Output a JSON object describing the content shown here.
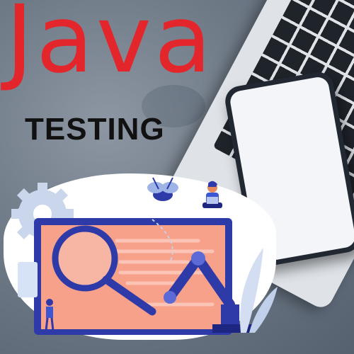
{
  "headline": "Java",
  "subheadline": "TESTING",
  "colors": {
    "headline": "#e3262b",
    "subheadline": "#111111",
    "background": "#6f7a87",
    "illustration_screen": "#f7a08a",
    "illustration_accent": "#2e3aa8"
  },
  "icons": [
    "gear-icon",
    "magnifying-glass-icon",
    "robotic-arm-icon",
    "bug-icon",
    "person-with-laptop-icon",
    "plant-icon"
  ]
}
